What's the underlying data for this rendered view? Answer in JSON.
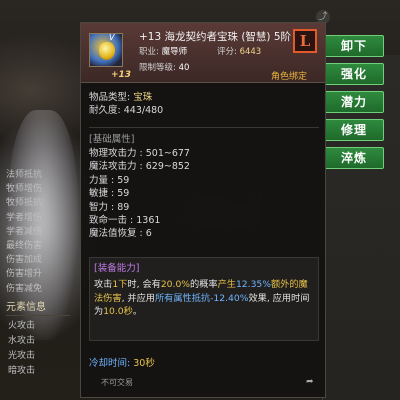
{
  "item": {
    "title": "+13 海龙契约者宝珠 (智慧) 5阶",
    "grade_letter": "L",
    "grade_mark": "V",
    "enhance": "+13",
    "job_label": "职业:",
    "job_value": "魔导师",
    "score_label": "评分:",
    "score_value": "6443",
    "level_label": "限制等级:",
    "level_value": "40",
    "bind_status": "角色绑定",
    "type_label": "物品类型:",
    "type_value": "宝珠",
    "durability_label": "耐久度:",
    "durability_value": "443/480"
  },
  "base_stats": {
    "title": "[基础属性]",
    "lines": [
      {
        "label": "物理攻击力 : ",
        "value": "501~677"
      },
      {
        "label": "魔法攻击力 : ",
        "value": "629~852"
      },
      {
        "label": "力量 : ",
        "value": "59"
      },
      {
        "label": "敏捷 : ",
        "value": "59"
      },
      {
        "label": "智力 : ",
        "value": "89"
      },
      {
        "label": "致命一击 : ",
        "value": "1361"
      },
      {
        "label": "魔法值恢复 : ",
        "value": "6"
      }
    ]
  },
  "equip_ability": {
    "title": "[装备能力]",
    "seg1": "攻击",
    "seg2": "1下",
    "seg3": "时, 会有",
    "seg4": "20.0%",
    "seg5": "的概率",
    "seg6": "产生",
    "seg7": "12.35%",
    "seg8": "额外的魔法伤害",
    "seg9": ", 并应用",
    "seg10": "所有属性抵抗-12.40%",
    "seg11": "效果, 应用时间为",
    "seg12": "10.0秒",
    "seg13": "。"
  },
  "cooldown": {
    "label": "冷却时间:",
    "value": "30秒"
  },
  "footer": {
    "trade": "不可交易",
    "share_glyph": "➦"
  },
  "actions": [
    "卸下",
    "强化",
    "潜力",
    "修理",
    "淬炼"
  ],
  "right_list": [
    "法师抵抗",
    "牧师增伤",
    "牧师抵抗",
    "学者增伤",
    "学者减伤",
    "最终伤害",
    "伤害加成",
    "伤害增升",
    "伤害减免"
  ],
  "element_panel": {
    "title": "元素信息",
    "items": [
      "火攻击",
      "水攻击",
      "光攻击",
      "暗攻击"
    ]
  },
  "colors": {
    "accent_green": "#2f8a3e",
    "legend_orange": "#e05a2a",
    "gold": "#f0d78a",
    "blue": "#6fb5ff",
    "purple": "#c17ce9"
  }
}
